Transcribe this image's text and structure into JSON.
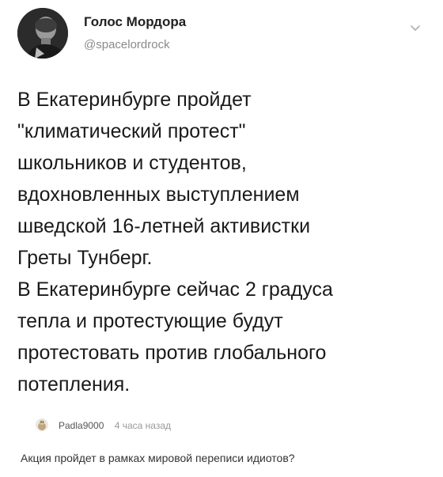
{
  "tweet": {
    "author": {
      "display_name": "Голос Мордора",
      "handle": "@spacelordrock",
      "avatar_icon": "avatar-photo-icon"
    },
    "menu_icon": "chevron-down-icon",
    "text_lines": [
      "В Екатеринбурге пройдет",
      "\"климатический протест\"",
      "школьников и студентов,",
      "вдохновленных выступлением",
      "шведской 16-летней активистки",
      "Греты Тунберг.",
      "В Екатеринбурге сейчас 2 градуса",
      "тепла и протестующие будут",
      "протестовать против глобального",
      "потепления."
    ]
  },
  "comment": {
    "avatar_icon": "comment-avatar-icon",
    "username": "Padla9000",
    "time": "4 часа назад",
    "text": "Акция пройдет в рамках мировой переписи идиотов?"
  },
  "colors": {
    "text": "#1a1a1a",
    "handle": "#8a8a8a",
    "meta": "#999999"
  }
}
